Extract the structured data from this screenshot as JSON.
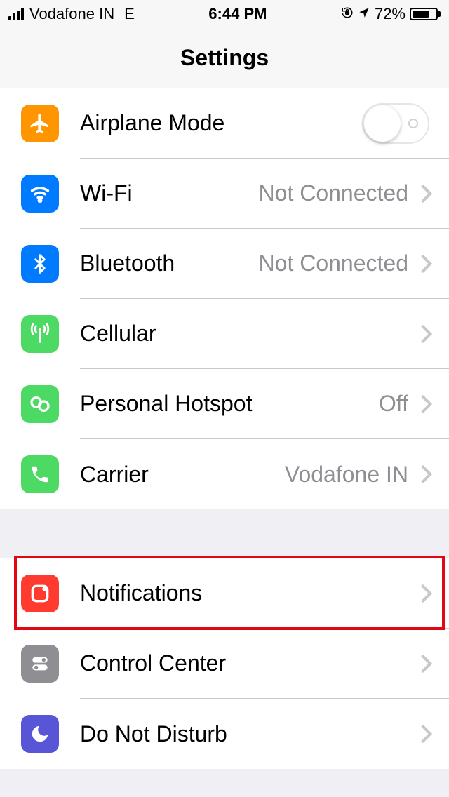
{
  "statusBar": {
    "carrier": "Vodafone IN",
    "network": "E",
    "time": "6:44 PM",
    "batteryPct": "72%"
  },
  "header": {
    "title": "Settings"
  },
  "groups": [
    {
      "rows": [
        {
          "id": "airplane",
          "label": "Airplane Mode",
          "type": "toggle",
          "value": "off"
        },
        {
          "id": "wifi",
          "label": "Wi-Fi",
          "detail": "Not Connected",
          "type": "nav"
        },
        {
          "id": "bluetooth",
          "label": "Bluetooth",
          "detail": "Not Connected",
          "type": "nav"
        },
        {
          "id": "cellular",
          "label": "Cellular",
          "type": "nav"
        },
        {
          "id": "hotspot",
          "label": "Personal Hotspot",
          "detail": "Off",
          "type": "nav"
        },
        {
          "id": "carrier",
          "label": "Carrier",
          "detail": "Vodafone IN",
          "type": "nav"
        }
      ]
    },
    {
      "rows": [
        {
          "id": "notifications",
          "label": "Notifications",
          "type": "nav",
          "highlighted": true
        },
        {
          "id": "controlcenter",
          "label": "Control Center",
          "type": "nav"
        },
        {
          "id": "dnd",
          "label": "Do Not Disturb",
          "type": "nav"
        }
      ]
    }
  ]
}
